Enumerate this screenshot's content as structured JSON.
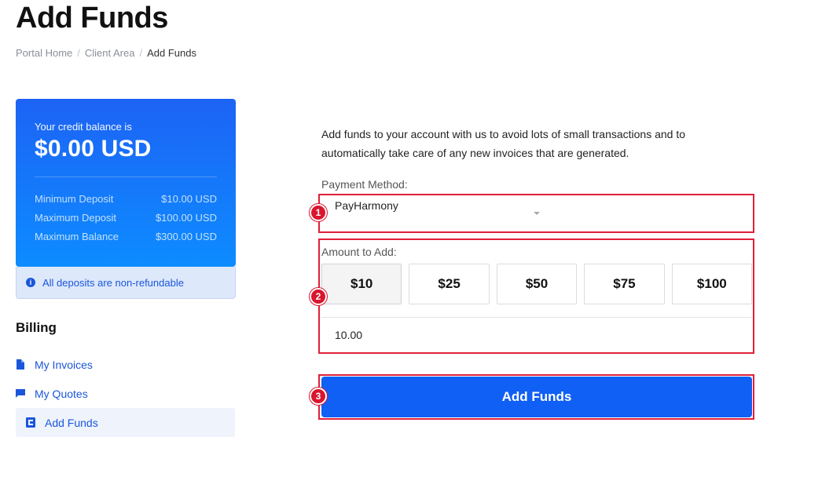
{
  "page": {
    "title": "Add Funds"
  },
  "breadcrumb": {
    "items": [
      "Portal Home",
      "Client Area",
      "Add Funds"
    ],
    "separator": "/"
  },
  "credit": {
    "label": "Your credit balance is",
    "amount": "$0.00 USD",
    "limits": [
      {
        "label": "Minimum Deposit",
        "value": "$10.00 USD"
      },
      {
        "label": "Maximum Deposit",
        "value": "$100.00 USD"
      },
      {
        "label": "Maximum Balance",
        "value": "$300.00 USD"
      }
    ],
    "gradient_start": "#1d63f5",
    "gradient_end": "#0d8cff"
  },
  "notice": {
    "icon": "info-icon",
    "text": "All deposits are non-refundable"
  },
  "sidebar": {
    "heading": "Billing",
    "items": [
      {
        "label": "My Invoices",
        "icon": "document-icon",
        "active": false
      },
      {
        "label": "My Quotes",
        "icon": "flag-icon",
        "active": false
      },
      {
        "label": "Add Funds",
        "icon": "add-funds-icon",
        "active": true
      }
    ]
  },
  "main": {
    "intro": "Add funds to your account with us to avoid lots of small transactions and to automatically take care of any new invoices that are generated.",
    "payment_method_label": "Payment Method:",
    "payment_method_value": "PayHarmony",
    "amount_label": "Amount to Add:",
    "amount_options": [
      "$10",
      "$25",
      "$50",
      "$75",
      "$100"
    ],
    "selected_amount_index": 0,
    "amount_value": "10.00",
    "submit_label": "Add Funds"
  },
  "annotations": {
    "markers": [
      "1",
      "2",
      "3"
    ],
    "color": "#e0203a"
  },
  "colors": {
    "accent": "#1160f5",
    "link": "#1a56db"
  }
}
